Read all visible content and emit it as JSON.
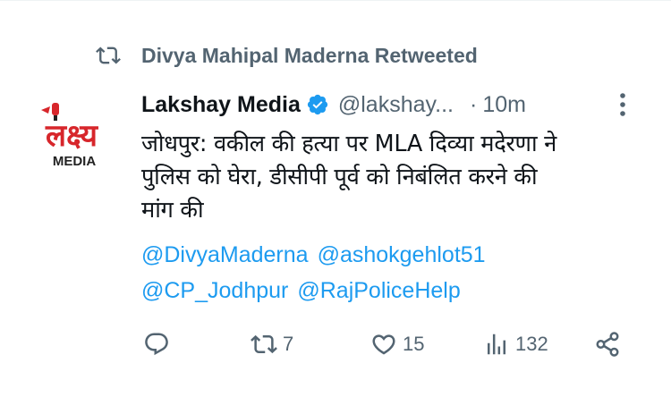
{
  "retweet": {
    "icon": "retweet-icon",
    "text": "Divya Mahipal Maderna Retweeted"
  },
  "avatar": {
    "logo_text": "लक्ष्य",
    "logo_sub": "MEDIA",
    "colors": {
      "red": "#d7262b",
      "dark": "#222222"
    }
  },
  "tweet": {
    "name": "Lakshay Media",
    "verified_icon": "verified-badge-icon",
    "handle": "@lakshay...",
    "separator": "·",
    "time": "10m",
    "more_icon": "more-icon",
    "text_lines": [
      "जोधपुर: वकील की हत्या पर MLA दिव्या मदेरणा ने",
      "पुलिस को घेरा, डीसीपी पूर्व को निबंलित करने की",
      "मांग की"
    ],
    "mentions": [
      [
        "@DivyaMaderna",
        "@ashokgehlot51"
      ],
      [
        "@CP_Jodhpur",
        "@RajPoliceHelp"
      ]
    ]
  },
  "actions": {
    "reply": {
      "icon": "reply-icon",
      "count": ""
    },
    "retweet": {
      "icon": "retweet-icon",
      "count": "7"
    },
    "like": {
      "icon": "heart-icon",
      "count": "15"
    },
    "views": {
      "icon": "views-icon",
      "count": "132"
    },
    "share": {
      "icon": "share-icon",
      "count": ""
    }
  },
  "colors": {
    "text": "#0f1419",
    "muted": "#536471",
    "link": "#1d9bf0",
    "verified": "#1d9bf0"
  }
}
